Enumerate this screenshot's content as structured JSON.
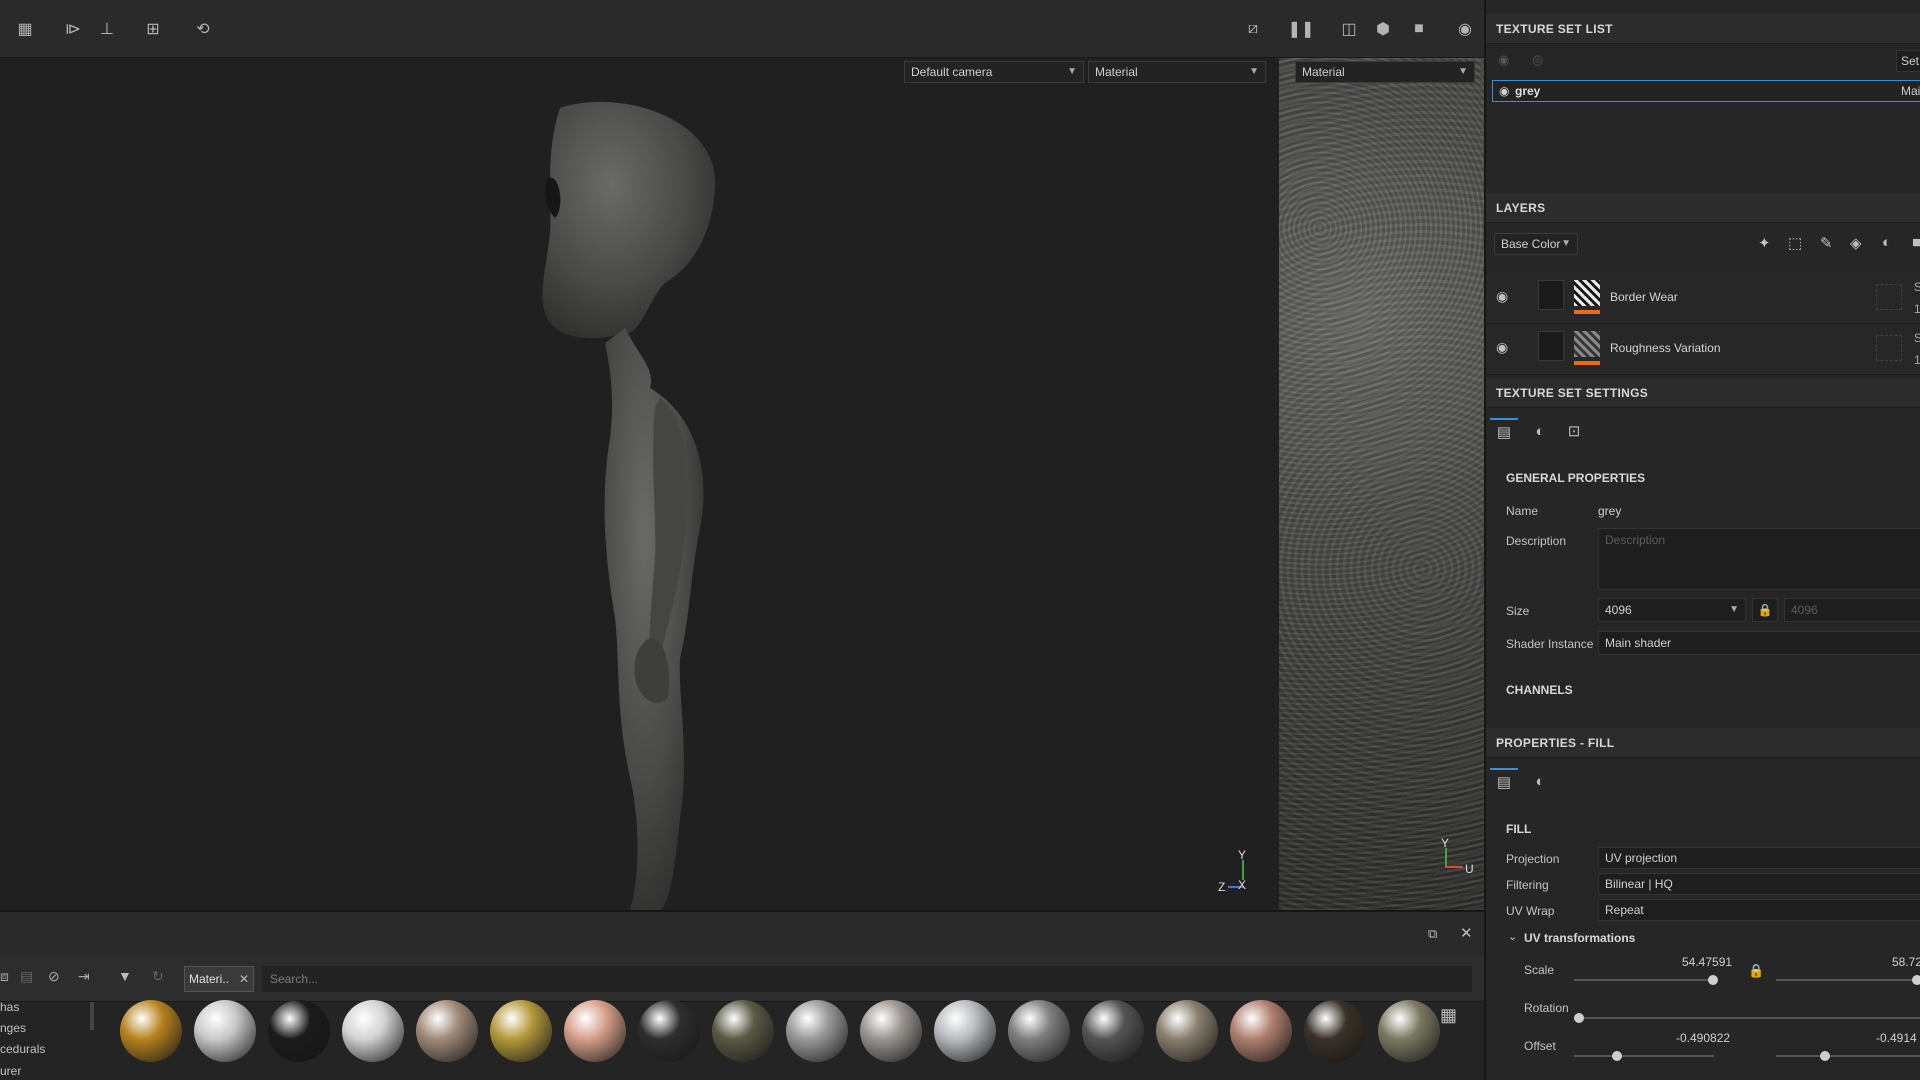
{
  "toolbar": {
    "left_icons": [
      "grid-icon",
      "symmetry-icon",
      "align-icon",
      "add-icon",
      "history-icon"
    ],
    "right_icons": [
      "hide-icon",
      "pause-icon",
      "split-view-icon",
      "cube-icon",
      "camera-icon",
      "screenshot-icon"
    ]
  },
  "viewport": {
    "camera_select": "Default camera",
    "mode_select": "Material",
    "uv_mode_select": "Material",
    "axis_y": "Y",
    "axis_z": "Z",
    "axis_x": "X",
    "uv_axis_y": "Y",
    "uv_axis_u": "U"
  },
  "texture_set_list": {
    "title": "TEXTURE SET LIST",
    "settings_label": "Set",
    "item_name": "grey",
    "item_shader": "Main"
  },
  "layers": {
    "title": "LAYERS",
    "channel_select": "Base Color",
    "items": [
      {
        "name": "Border Wear",
        "blend": "S",
        "opacity": "1"
      },
      {
        "name": "Roughness Variation",
        "blend": "S",
        "opacity": "1"
      }
    ]
  },
  "texture_set_settings": {
    "title": "TEXTURE SET SETTINGS",
    "general_title": "GENERAL PROPERTIES",
    "name_label": "Name",
    "name_value": "grey",
    "description_label": "Description",
    "description_placeholder": "Description",
    "size_label": "Size",
    "size_value": "4096",
    "size_value_locked": "4096",
    "shader_label": "Shader Instance",
    "shader_value": "Main shader",
    "channels_title": "CHANNELS"
  },
  "properties_fill": {
    "title": "PROPERTIES - FILL",
    "fill_title": "FILL",
    "projection_label": "Projection",
    "projection_value": "UV projection",
    "filtering_label": "Filtering",
    "filtering_value": "Bilinear | HQ",
    "uvwrap_label": "UV Wrap",
    "uvwrap_value": "Repeat",
    "uvt_title": "UV transformations",
    "scale_label": "Scale",
    "scale_value_1": "54.47591",
    "scale_value_2": "58.72",
    "rotation_label": "Rotation",
    "offset_label": "Offset",
    "offset_value_1": "-0.490822",
    "offset_value_2": "-0.4914"
  },
  "shelf": {
    "filter_chip": "Materi..",
    "search_placeholder": "Search...",
    "categories": [
      "has",
      "nges",
      "cedurals",
      "urer"
    ],
    "materials_colors": [
      "#b8831f",
      "#c9c9c9",
      "#1b1b1b",
      "#d3d3d3",
      "#a08b7a",
      "#b39a3a",
      "#d6a08a",
      "#2e2e2e",
      "#5a5a45",
      "#9a9a9a",
      "#9b9590",
      "#b8bcc0",
      "#7f7f7f",
      "#545454",
      "#8a7f6e",
      "#b08070",
      "#3a3128",
      "#7c7962"
    ]
  }
}
